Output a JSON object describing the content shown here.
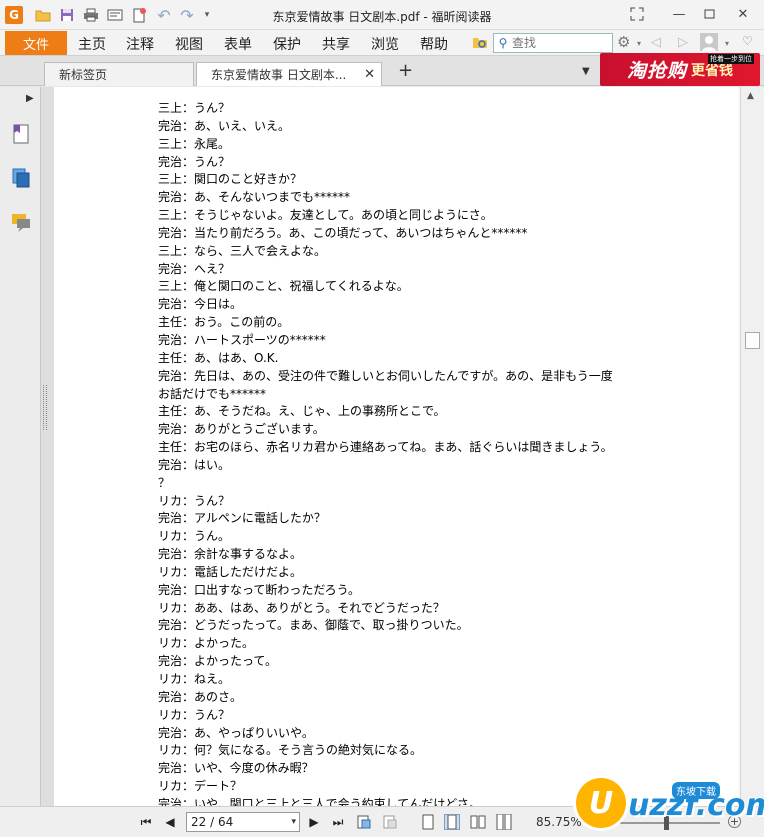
{
  "window": {
    "title": "东京爱情故事 日文剧本.pdf - 福昕阅读器"
  },
  "menu": {
    "file": "文件",
    "items": [
      "主页",
      "注释",
      "视图",
      "表单",
      "保护",
      "共享",
      "浏览",
      "帮助"
    ],
    "search_placeholder": "查找"
  },
  "tabs": [
    {
      "label": "新标签页",
      "active": false
    },
    {
      "label": "东京爱情故事 日文剧本...",
      "active": true
    }
  ],
  "ad": {
    "main": "淘抢购",
    "sub": "更省钱",
    "tag": "抢着一步到位"
  },
  "document": {
    "lines": [
      "三上：うん？",
      "完治：あ、いえ、いえ。",
      "三上：永尾。",
      "完治：うん？",
      "三上：関口のこと好きか？",
      "完治：あ、そんないつまでも******",
      "三上：そうじゃないよ。友達として。あの頃と同じようにさ。",
      "完治：当たり前だろう。あ、この頃だって、あいつはちゃんと******",
      "三上：なら、三人で会えよな。",
      "完治：へえ？",
      "三上：俺と関口のこと、祝福してくれるよな。",
      "完治：今日は。",
      "主任：おう。この前の。",
      "完治：ハートスポーツの******",
      "主任：あ、はあ、O.K.",
      "完治：先日は、あの、受注の件で難しいとお伺いしたんですが。あの、是非もう一度",
      "お話だけでも******",
      "主任：あ、そうだね。え、じゃ、上の事務所とこで。",
      "完治：ありがとうございます。",
      "主任：お宅のほら、赤名リカ君から連絡あってね。まあ、話ぐらいは聞きましょう。",
      "完治：はい。",
      "？",
      "リカ：うん？",
      "完治：アルペンに電話したか？",
      "リカ：うん。",
      "完治：余計な事するなよ。",
      "リカ：電話しただけだよ。",
      "完治：口出すなって断わっただろう。",
      "リカ：ああ、はあ、ありがとう。それでどうだった？",
      "完治：どうだったって。まあ、御蔭で、取っ掛りついた。",
      "リカ：よかった。",
      "完治：よかったって。",
      "リカ：ねえ。",
      "完治：あのさ。",
      "リカ：うん？",
      "完治：あ、やっぱりいいや。",
      "リカ：何？気になる。そう言うの絶対気になる。",
      "完治：いや、今度の休み暇？",
      "リカ：デート？",
      "完治：いや、関口と三上と三人で会う約束してんだけどさ。"
    ]
  },
  "status": {
    "page": "22 / 64",
    "zoom": "85.75%"
  },
  "watermark": {
    "logo": "U",
    "text": "uzzf.com",
    "badge": "东坡下载"
  }
}
